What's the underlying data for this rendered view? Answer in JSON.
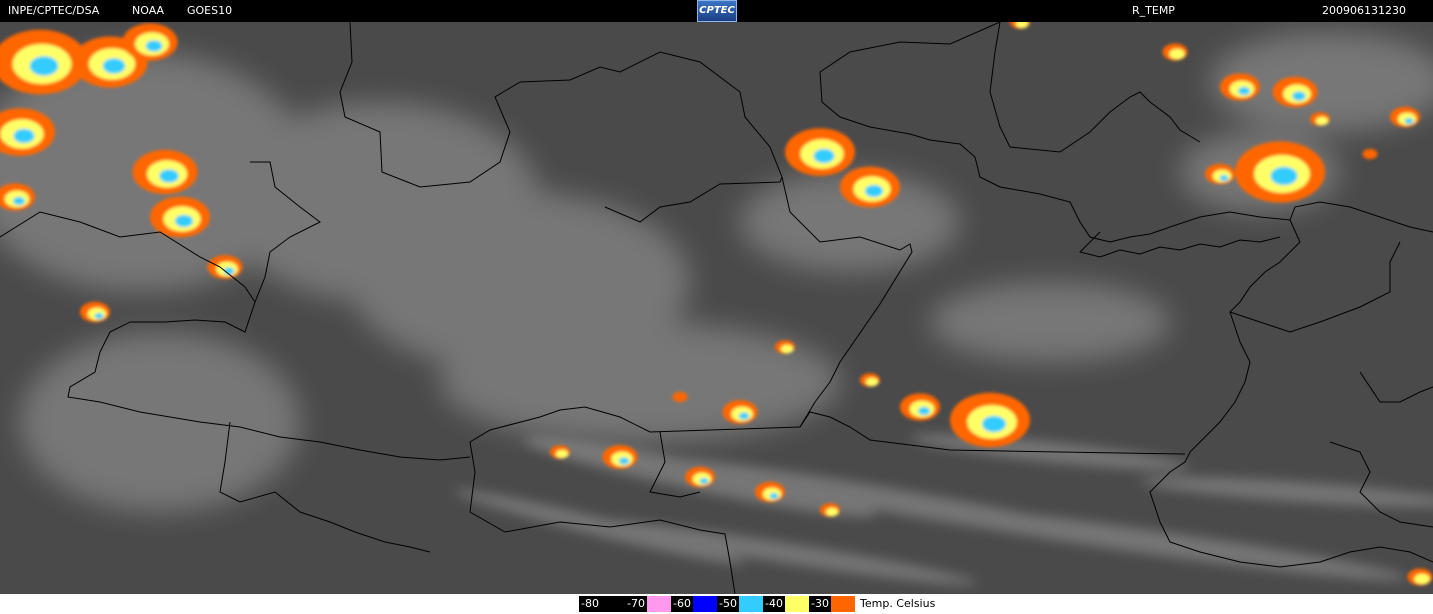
{
  "header": {
    "source": "INPE/CPTEC/DSA",
    "agency": "NOAA",
    "satellite": "GOES10",
    "logo": "CPTEC",
    "product": "R_TEMP",
    "timestamp": "200906131230"
  },
  "map": {
    "background_color": "#4a4a4a",
    "border_color": "#000000"
  },
  "legend": {
    "items": [
      {
        "label": "-80",
        "color": "#000000"
      },
      {
        "label": "-70",
        "color": "#ff99ee"
      },
      {
        "label": "-60",
        "color": "#0000ff"
      },
      {
        "label": "-50",
        "color": "#33ccff"
      },
      {
        "label": "-40",
        "color": "#ffff66"
      },
      {
        "label": "-30",
        "color": "#ff6600"
      }
    ],
    "unit": "Temp. Celsius"
  }
}
